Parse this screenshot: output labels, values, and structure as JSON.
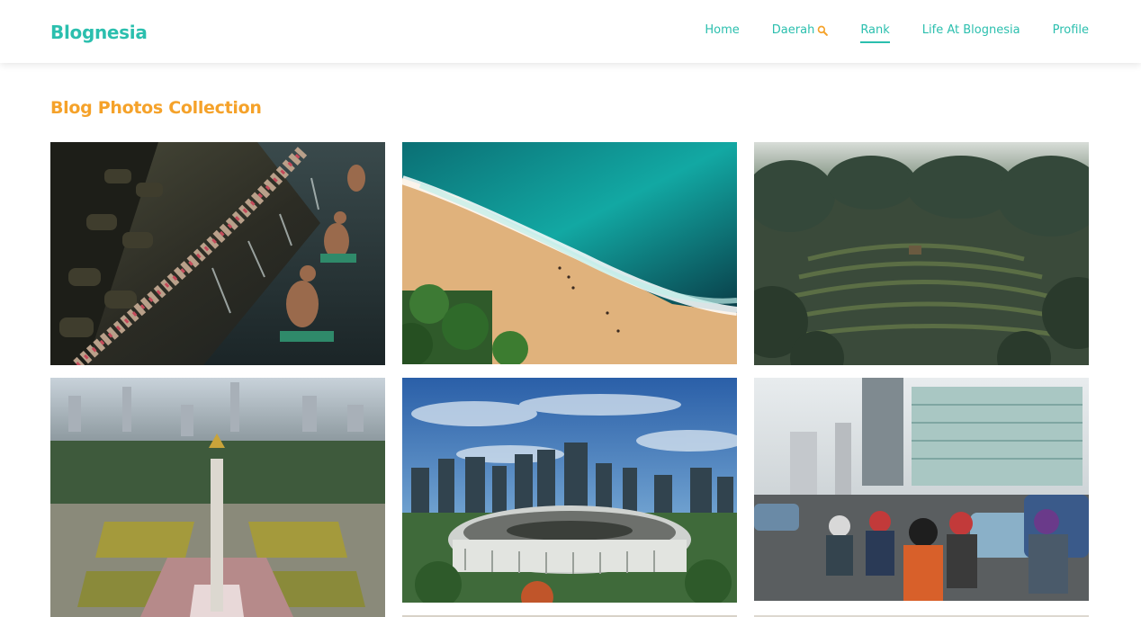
{
  "brand": {
    "name": "Blognesia",
    "color": "#2bbfae"
  },
  "nav": {
    "items": [
      {
        "label": "Home",
        "active": false
      },
      {
        "label": "Daerah",
        "icon": "search-icon",
        "active": false
      },
      {
        "label": "Rank",
        "active": true
      },
      {
        "label": "Life At Blognesia",
        "active": false
      },
      {
        "label": "Profile",
        "active": false
      }
    ]
  },
  "gallery": {
    "title": "Blog Photos Collection",
    "title_color": "#f5a22a",
    "photos": [
      {
        "subject": "temple-bathing-photo"
      },
      {
        "subject": "aerial-beach-photo"
      },
      {
        "subject": "rice-terrace-photo"
      },
      {
        "subject": "national-monument-photo"
      },
      {
        "subject": "stadium-skyline-photo"
      },
      {
        "subject": "motorbike-traffic-photo"
      }
    ]
  }
}
